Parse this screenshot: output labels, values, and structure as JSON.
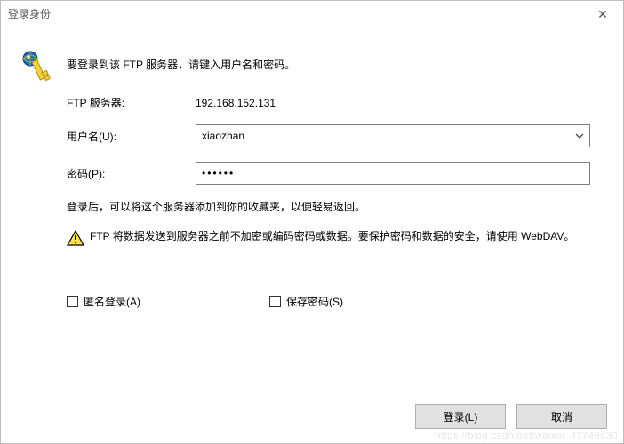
{
  "window": {
    "title": "登录身份"
  },
  "intro": "要登录到该 FTP 服务器，请键入用户名和密码。",
  "form": {
    "serverLabel": "FTP 服务器:",
    "serverValue": "192.168.152.131",
    "userLabel": "用户名(U):",
    "userValue": "xiaozhan",
    "passLabel": "密码(P):",
    "passMasked": "••••••"
  },
  "note": "登录后，可以将这个服务器添加到你的收藏夹，以便轻易返回。",
  "warning": "FTP 将数据发送到服务器之前不加密或编码密码或数据。要保护密码和数据的安全，请使用 WebDAV。",
  "checks": {
    "anon": "匿名登录(A)",
    "save": "保存密码(S)"
  },
  "buttons": {
    "login": "登录(L)",
    "cancel": "取消"
  },
  "watermark": "https://blog.csdn.net/weixin_47746630"
}
